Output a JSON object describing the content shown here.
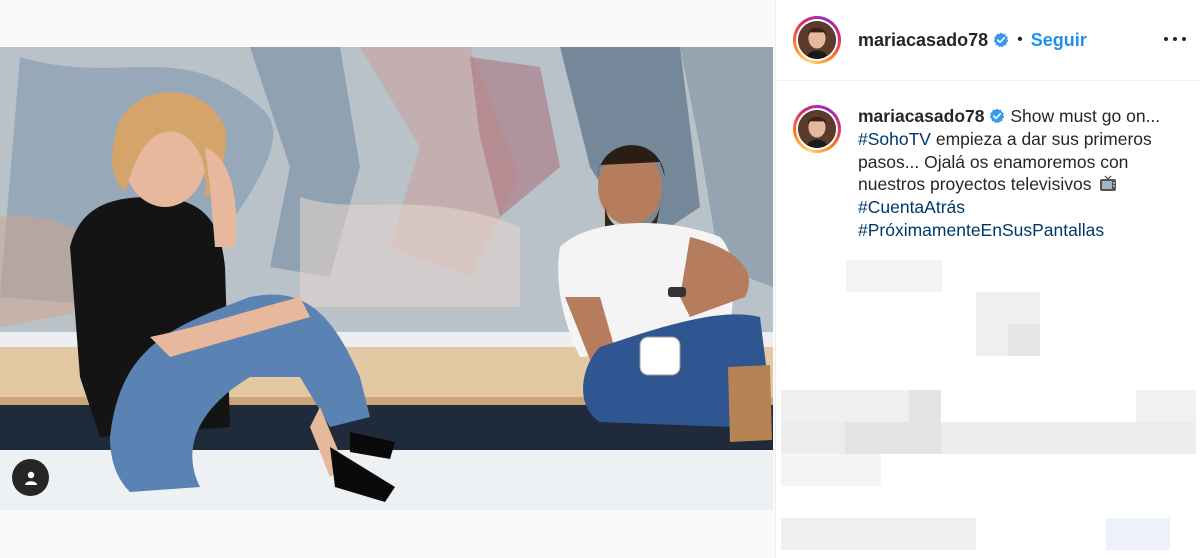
{
  "post": {
    "username": "mariacasado78",
    "follow_label": "Seguir",
    "separator": "•"
  },
  "caption": {
    "username": "mariacasado78",
    "text_1": "Show must go on...",
    "hashtag_1": "#SohoTV",
    "text_2": "empieza a dar sus primeros pasos... Ojalá os enamoremos con nuestros proyectos televisivos",
    "hashtag_2": "#CuentaAtrás",
    "hashtag_3": "#PróximamenteEnSusPantallas"
  },
  "icons": {
    "verified": "verified-badge-icon",
    "more": "more-options-icon",
    "tag": "user-tag-icon",
    "tv": "tv-emoji-icon"
  },
  "colors": {
    "accent": "#1e8ff0",
    "hashtag": "#00376b",
    "text": "#262626",
    "divider": "#efefef"
  }
}
